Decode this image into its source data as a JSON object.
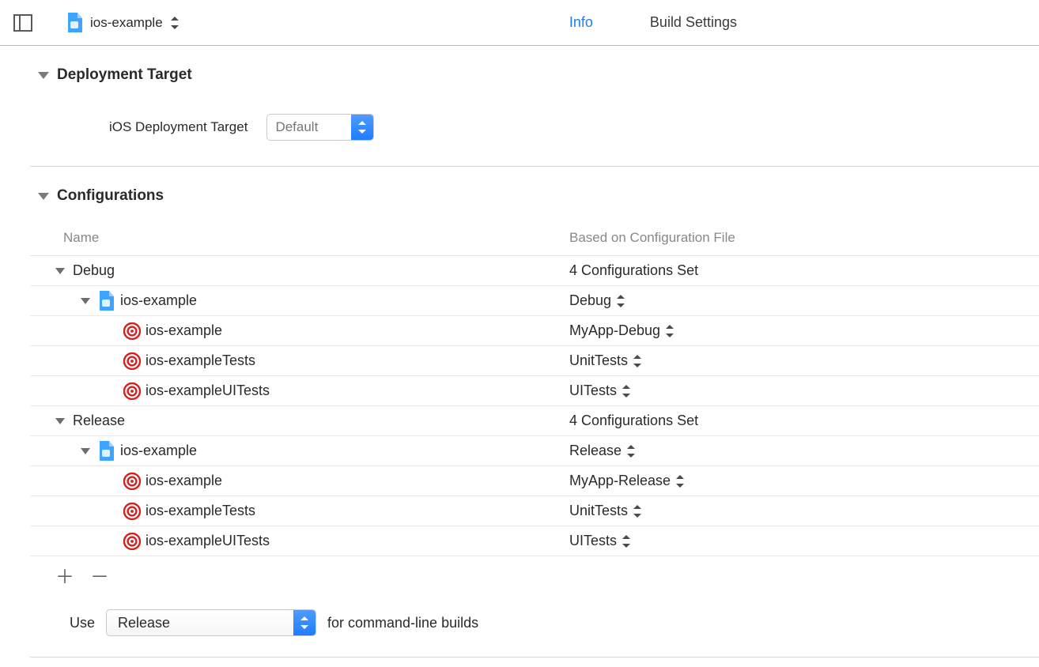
{
  "header": {
    "project_name": "ios-example",
    "tabs": {
      "info": "Info",
      "build_settings": "Build Settings"
    }
  },
  "deployment": {
    "section_title": "Deployment Target",
    "label": "iOS Deployment Target",
    "value_placeholder": "Default"
  },
  "configurations": {
    "section_title": "Configurations",
    "columns": {
      "name": "Name",
      "file": "Based on Configuration File"
    },
    "groups": [
      {
        "name": "Debug",
        "summary": "4 Configurations Set",
        "project": {
          "name": "ios-example",
          "file": "Debug",
          "targets": [
            {
              "name": "ios-example",
              "file": "MyApp-Debug"
            },
            {
              "name": "ios-exampleTests",
              "file": "UnitTests"
            },
            {
              "name": "ios-exampleUITests",
              "file": "UITests"
            }
          ]
        }
      },
      {
        "name": "Release",
        "summary": "4 Configurations Set",
        "project": {
          "name": "ios-example",
          "file": "Release",
          "targets": [
            {
              "name": "ios-example",
              "file": "MyApp-Release"
            },
            {
              "name": "ios-exampleTests",
              "file": "UnitTests"
            },
            {
              "name": "ios-exampleUITests",
              "file": "UITests"
            }
          ]
        }
      }
    ],
    "use_label": "Use",
    "use_value": "Release",
    "use_suffix": "for command-line builds"
  }
}
